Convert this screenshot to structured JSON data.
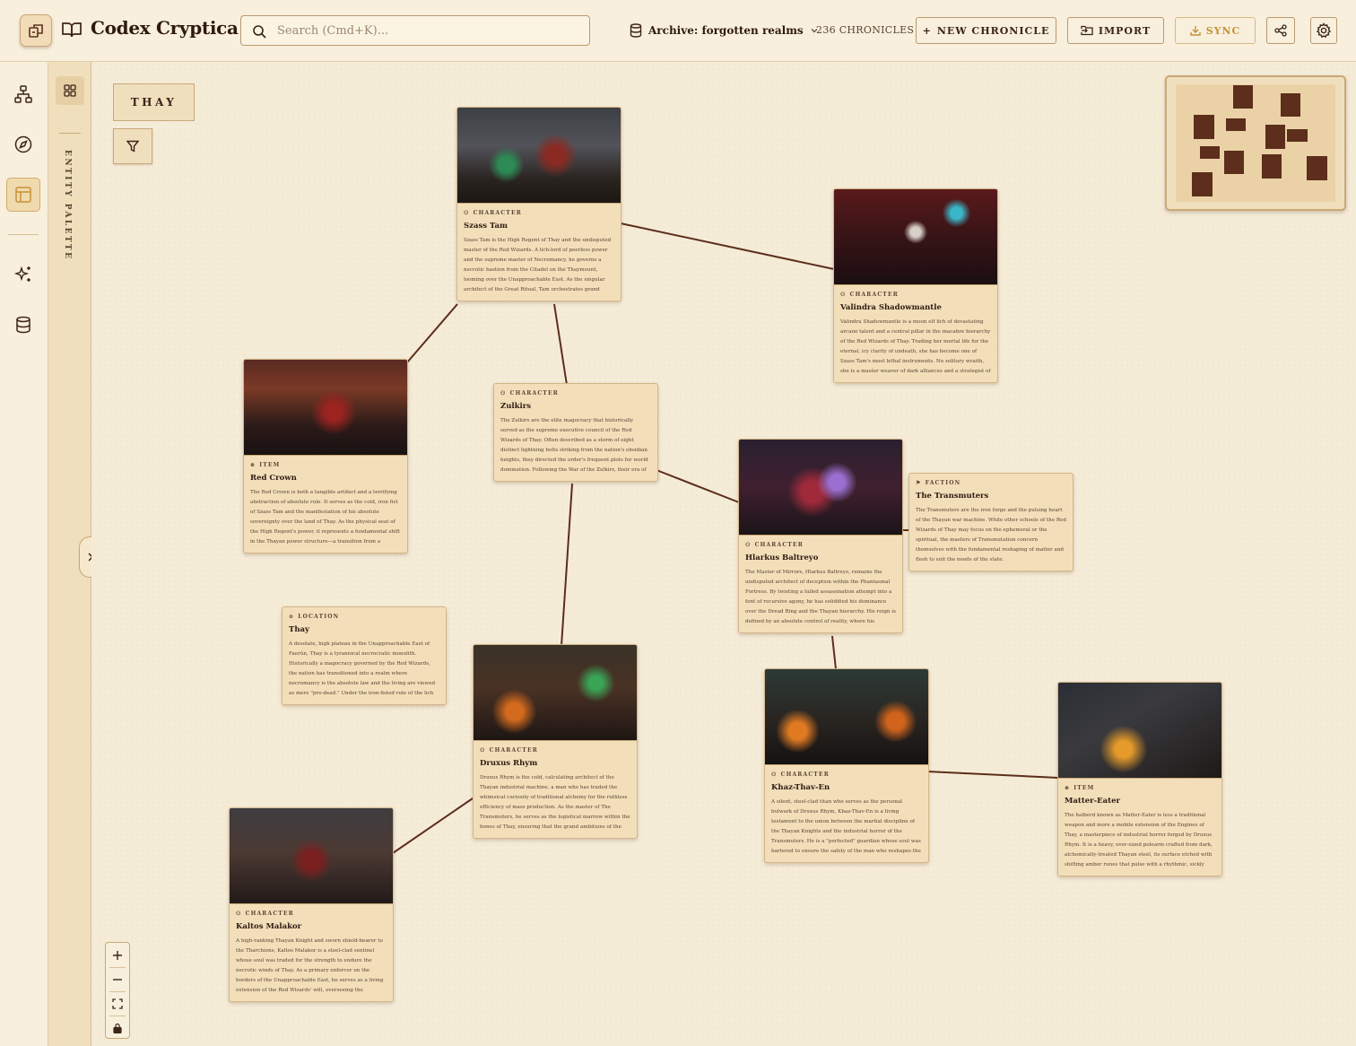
{
  "app": {
    "title": "Codex Cryptica",
    "search_placeholder": "Search (Cmd+K)...",
    "archive_label": "Archive: forgotten realms",
    "count_label": "236 CHRONICLES",
    "buttons": {
      "new_chronicle": "NEW CHRONICLE",
      "import": "IMPORT",
      "sync": "SYNC"
    }
  },
  "palette": {
    "label": "ENTITY PALETTE"
  },
  "canvas": {
    "region_label": "THAY"
  },
  "cards": [
    {
      "key": "szass-tam",
      "type": "CHARACTER",
      "title": "Szass Tam",
      "description": "Szass Tam is the High Regent of Thay and the undisputed master of the Red Wizards. A lich-lord of peerless power and the supreme master of Necromancy, he governs a necrotic bastion from the Citadel on the Thaymount, looming over the Unapproachable East. As the singular architect of the Great Ritual, Tam orchestrates grand designs to harvest..."
    },
    {
      "key": "valindra",
      "type": "CHARACTER",
      "title": "Valindra Shadowmantle",
      "description": "Valindra Shadowmantle is a moon elf lich of devastating arcane talent and a central pillar in the macabre hierarchy of the Red Wizards of Thay. Trading her mortal life for the eternal, icy clarity of undeath, she has become one of Szass Tam's most lethal instruments. No solitary wraith, she is a master weaver of dark alliances and a strategist of siege-cra..."
    },
    {
      "key": "red-crown",
      "type": "ITEM",
      "title": "Red Crown",
      "description": "The Red Crown is both a tangible artifact and a terrifying abstraction of absolute rule. It serves as the cold, iron fist of Szass Tam and the manifestation of his absolute sovereignty over the land of Thay. As the physical seat of the High Regent's power, it represents a fundamental shift in the Thayan power structure—a transition from a fractious..."
    },
    {
      "key": "zulkirs",
      "type": "CHARACTER",
      "title": "Zulkirs",
      "description": "The Zulkirs are the elite magocracy that historically served as the supreme executive council of the Red Wizards of Thay. Often described as a storm of eight distinct lightning bolts striking from the nation's obsidian heights, they directed the order's frequent plots for world domination. Following the War of the Zulkirs, their era of collective rule ended; the..."
    },
    {
      "key": "hlarkus",
      "type": "CHARACTER",
      "title": "Hlarkus Baltreyo",
      "description": "The Master of Mirrors, Hlarkus Baltreyo, remains the undisputed architect of deception within the Phantasmal Fortress. By twisting a failed assassination attempt into a font of recursive agony, he has solidified his dominance over the Dread Ring and the Thayan hierarchy. His reign is defined by an absolute control of reality, where his enemies'..."
    },
    {
      "key": "transmuters",
      "type": "FACTION",
      "title": "The Transmuters",
      "description": "The Transmuters are the iron forge and the pulsing heart of the Thayan war machine. While other schools of the Red Wizards of Thay may focus on the ephemeral or the spiritual, the masters of Transmutation concern themselves with the fundamental reshaping of matter and flesh to suit the needs of the state."
    },
    {
      "key": "thay",
      "type": "LOCATION",
      "title": "Thay",
      "description": "A desolate, high plateau in the Unapproachable East of Faerûn, Thay is a tyrannical necrocratic monolith. Historically a magocracy governed by the Red Wizards, the nation has transitioned into a realm where necromancy is the absolute law and the living are viewed as mere \"pre-dead.\" Under the iron-fisted rule of the lich Szass Tam, Thay serves as a..."
    },
    {
      "key": "druxus",
      "type": "CHARACTER",
      "title": "Druxus Rhym",
      "description": "Druxus Rhym is the cold, calculating architect of the Thayan industrial machine, a man who has traded the whimsical curiosity of traditional alchemy for the ruthless efficiency of mass production. As the master of The Transmuters, he serves as the logistical marrow within the bones of Thay, ensuring that the grand ambitions of the lich-lord Szass Ta..."
    },
    {
      "key": "khaz",
      "type": "CHARACTER",
      "title": "Khaz-Thav-En",
      "description": "A silent, steel-clad titan who serves as the personal bulwark of Druxus Rhym, Khaz-Thav-En is a living testament to the union between the martial discipline of the Thayan Knights and the industrial horror of the Transmuters. He is a \"perfected\" guardian whose soul was bartered to ensure the safety of the man who reshapes the world."
    },
    {
      "key": "matter-eater",
      "type": "ITEM",
      "title": "Matter-Eater",
      "description": "The halberd known as Matter-Eater is less a traditional weapon and more a mobile extension of the Engines of Thay, a masterpiece of industrial horror forged by Druxus Rhym. It is a heavy, over-sized polearm crafted from dark, alchemically-treated Thayan steel, its surface etched with shifting amber runes that pulse with a rhythmic, sickly light."
    },
    {
      "key": "kaltos",
      "type": "CHARACTER",
      "title": "Kaltos Malakor",
      "description": "A high-ranking Thayan Knight and sworn shield-bearer to the Tharchions, Kaltos Malakor is a steel-clad sentinel whose soul was traded for the strength to endure the necrotic winds of Thay. As a primary enforcer on the borders of the Unapproachable East, he serves as a living extension of the Red Wizards' will, overseeing the plateau's \"pre-dead\" legio..."
    }
  ],
  "colors": {
    "accent": "#c59237",
    "ink": "#2e1a10",
    "link_line": "#5c2e1b",
    "card_bg": "#f2dfba"
  }
}
